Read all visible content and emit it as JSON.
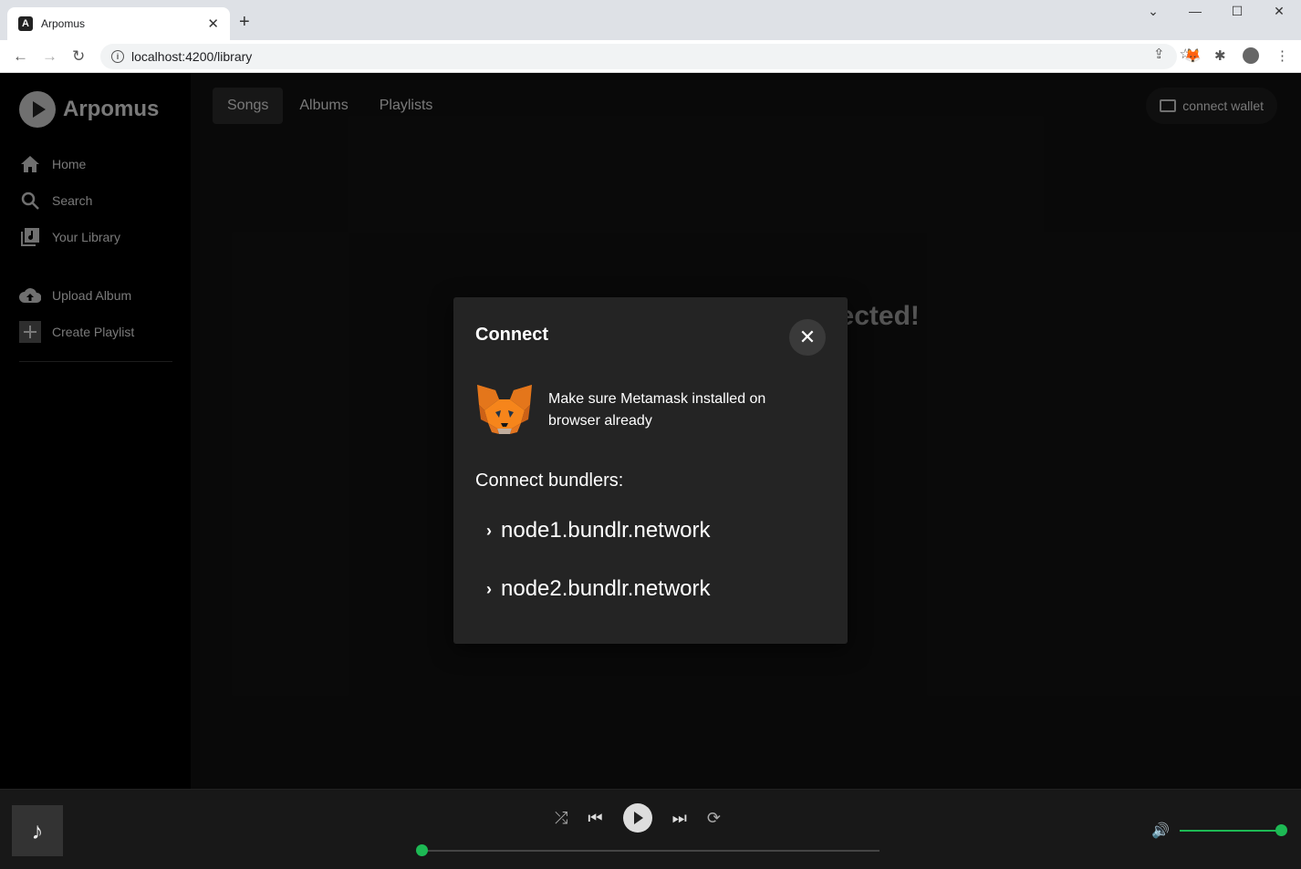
{
  "browser": {
    "tab_title": "Arpomus",
    "url": "localhost:4200/library"
  },
  "app": {
    "brand": "Arpomus",
    "sidebar": {
      "items": [
        {
          "label": "Home",
          "icon": "home-icon"
        },
        {
          "label": "Search",
          "icon": "search-icon"
        },
        {
          "label": "Your Library",
          "icon": "library-icon"
        },
        {
          "label": "Upload Album",
          "icon": "cloud-upload-icon"
        },
        {
          "label": "Create Playlist",
          "icon": "plus-box-icon"
        }
      ]
    },
    "tabs": [
      {
        "label": "Songs",
        "active": true
      },
      {
        "label": "Albums",
        "active": false
      },
      {
        "label": "Playlists",
        "active": false
      }
    ],
    "wallet_button": "connect wallet",
    "background_message": "Wallet Not Connected!"
  },
  "modal": {
    "title": "Connect",
    "metamask_text": "Make sure Metamask installed on browser already",
    "bundlers_label": "Connect bundlers:",
    "bundlers": [
      "node1.bundlr.network",
      "node2.bundlr.network"
    ]
  },
  "player": {
    "progress": 0,
    "volume": 1.0,
    "accent_color": "#1db954"
  }
}
